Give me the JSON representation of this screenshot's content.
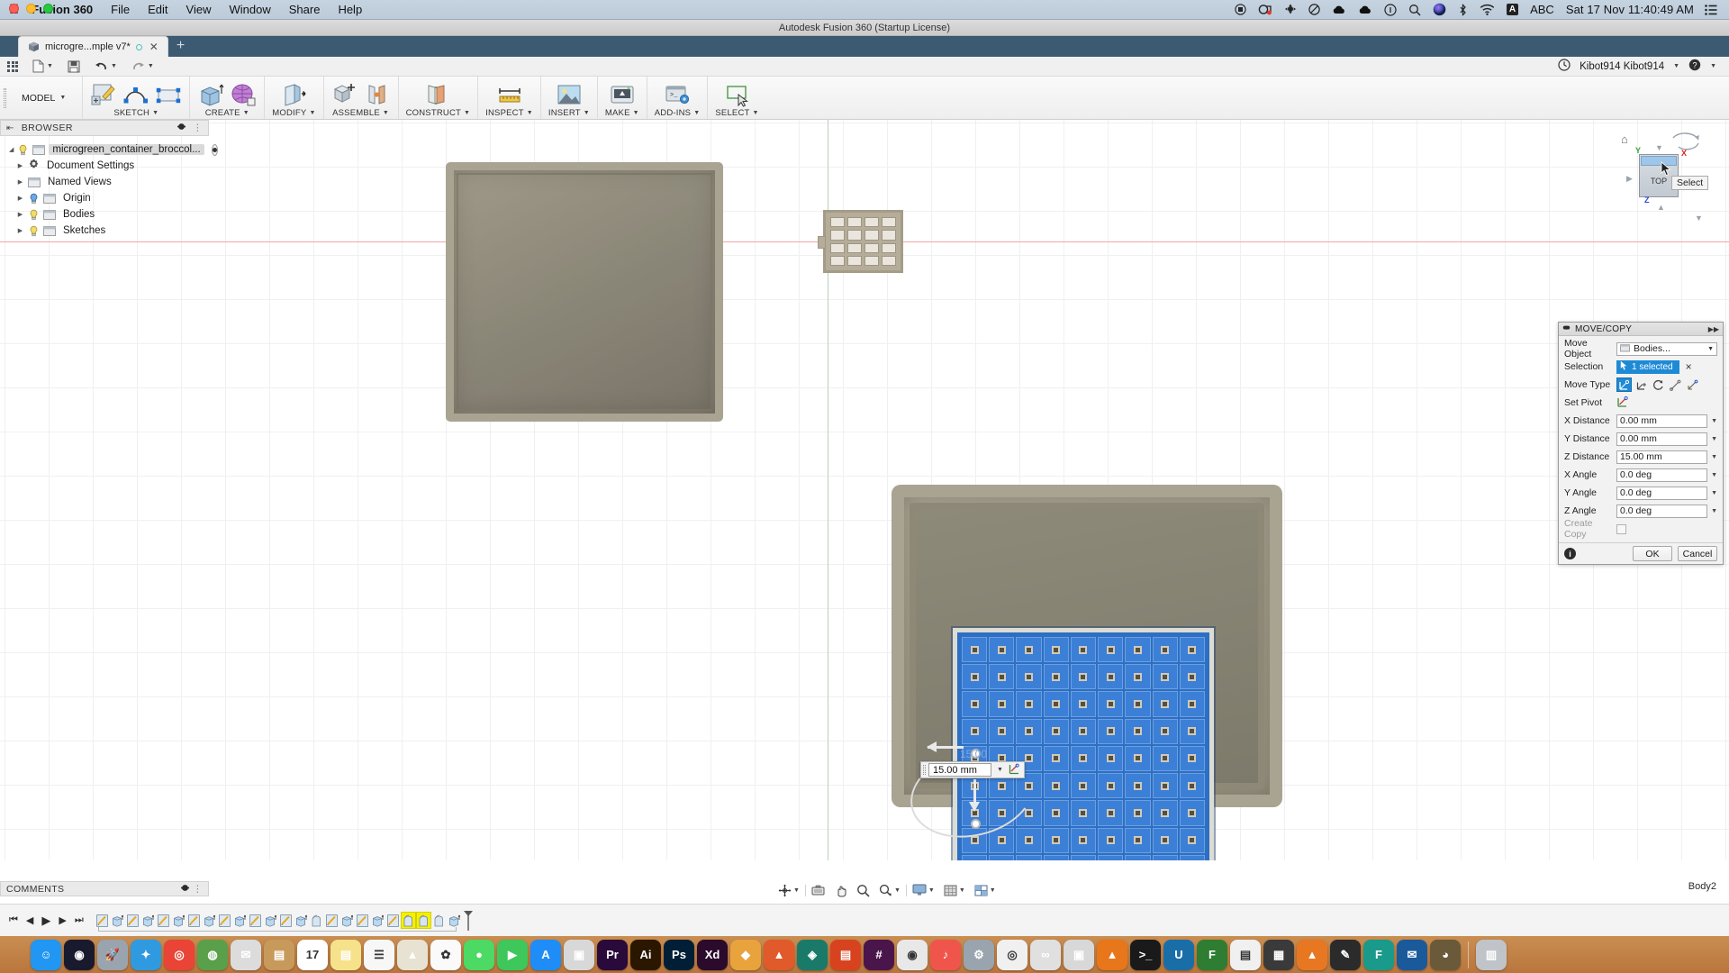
{
  "macbar": {
    "apple_icon": "apple-icon",
    "menus": [
      "Fusion 360",
      "File",
      "Edit",
      "View",
      "Window",
      "Share",
      "Help"
    ],
    "status_icons": [
      "screen-record-icon",
      "webcam-recording-icon",
      "airplay-icon",
      "dnd-icon",
      "cloud-up-icon",
      "cloud-down-icon",
      "info-circle-icon",
      "search-icon",
      "siri-icon",
      "bluetooth-icon",
      "wifi-icon"
    ],
    "input_source_badge": "A",
    "input_source_label": "ABC",
    "clock": "Sat 17 Nov  11:40:49 AM",
    "control_center_icon": "control-center-icon"
  },
  "titlebar": {
    "title": "Autodesk Fusion 360 (Startup License)"
  },
  "tabs": {
    "items": [
      {
        "label": "microgre...mple v7*",
        "icon": "cube-icon",
        "save_dot": "unsaved-indicator",
        "close": "close-icon"
      }
    ],
    "new_tab_label": "+"
  },
  "qat": {
    "apps_grid_icon": "app-grid-icon",
    "file_icon": "file-icon",
    "save_icon": "save-icon",
    "undo_icon": "undo-icon",
    "redo_icon": "redo-icon",
    "history_icon": "history-clock-icon",
    "account": "Kibot914 Kibot914",
    "help_icon": "help-icon"
  },
  "ribbon": {
    "workspace": "MODEL",
    "groups": [
      {
        "label": "SKETCH",
        "icons": [
          "create-sketch-icon",
          "spline-icon",
          "rectangle-icon"
        ]
      },
      {
        "label": "CREATE",
        "icons": [
          "extrude-icon",
          "form-icon"
        ]
      },
      {
        "label": "MODIFY",
        "icons": [
          "press-pull-icon"
        ]
      },
      {
        "label": "ASSEMBLE",
        "icons": [
          "new-component-icon",
          "joint-icon"
        ]
      },
      {
        "label": "CONSTRUCT",
        "icons": [
          "offset-plane-icon"
        ]
      },
      {
        "label": "INSPECT",
        "icons": [
          "measure-icon"
        ]
      },
      {
        "label": "INSERT",
        "icons": [
          "insert-image-icon"
        ]
      },
      {
        "label": "MAKE",
        "icons": [
          "3d-print-icon"
        ]
      },
      {
        "label": "ADD-INS",
        "icons": [
          "scripts-addins-icon"
        ]
      },
      {
        "label": "SELECT",
        "icons": [
          "select-icon"
        ]
      }
    ]
  },
  "browser": {
    "header": "BROWSER",
    "collapse_icon": "collapse-left-icon",
    "settings_icon": "panel-settings-icon",
    "root": {
      "label": "microgreen_container_broccol...",
      "bulb": "light-bulb-icon",
      "doc_icon": "document-icon",
      "visibility": "visibility-toggle"
    },
    "items": [
      {
        "label": "Document Settings",
        "icon": "gear-icon",
        "arrow": "chevron-right-icon"
      },
      {
        "label": "Named Views",
        "icon": "folder-icon",
        "arrow": "chevron-right-icon"
      },
      {
        "label": "Origin",
        "icon": "folder-icon",
        "arrow": "chevron-right-icon",
        "bulb": "light-bulb-on-icon"
      },
      {
        "label": "Bodies",
        "icon": "folder-icon",
        "arrow": "chevron-right-icon",
        "bulb": "light-bulb-icon"
      },
      {
        "label": "Sketches",
        "icon": "folder-icon",
        "arrow": "chevron-right-icon",
        "bulb": "light-bulb-icon"
      }
    ]
  },
  "viewcube": {
    "face_label": "TOP",
    "tooltip": "Select",
    "axis_x": "X",
    "axis_y": "Y",
    "axis_z": "Z",
    "home_icon": "home-icon",
    "orbit_icon": "orbit-arrow-icon"
  },
  "canvas": {
    "dimension_input": {
      "value": "15.00 mm",
      "ghost_label": "15.00",
      "dropdown_icon": "chevron-down-icon",
      "pivot_icon": "set-pivot-icon"
    },
    "arrow_left_icon": "move-arrow-left-icon",
    "arrow_down_icon": "move-arrow-down-icon"
  },
  "movecopy": {
    "title": "MOVE/COPY",
    "pin_icon": "pin-icon",
    "expand_icon": "expand-right-icon",
    "rows": [
      {
        "label": "Move Object",
        "type": "select",
        "value": "Bodies...",
        "icon": "bodies-icon"
      },
      {
        "label": "Selection",
        "type": "selectbtn",
        "value": "1 selected",
        "clear": "×",
        "icon": "cursor-icon"
      },
      {
        "label": "Move Type",
        "type": "movetype",
        "options": [
          "translate-rotate-icon",
          "point-to-point-icon",
          "rotate-icon",
          "point-to-position-icon",
          "free-move-icon"
        ],
        "active": 0
      },
      {
        "label": "Set Pivot",
        "type": "pivot",
        "icon": "set-pivot-icon"
      },
      {
        "label": "X Distance",
        "type": "field",
        "value": "0.00 mm"
      },
      {
        "label": "Y Distance",
        "type": "field",
        "value": "0.00 mm"
      },
      {
        "label": "Z Distance",
        "type": "field",
        "value": "15.00 mm"
      },
      {
        "label": "X Angle",
        "type": "field",
        "value": "0.0 deg"
      },
      {
        "label": "Y Angle",
        "type": "field",
        "value": "0.0 deg"
      },
      {
        "label": "Z Angle",
        "type": "field",
        "value": "0.0 deg"
      },
      {
        "label": "Create Copy",
        "type": "checkbox",
        "value": "",
        "disabled": true
      }
    ],
    "info_icon": "info-icon",
    "ok_label": "OK",
    "cancel_label": "Cancel",
    "accent_color": "#1e8ad6"
  },
  "navbar": {
    "items": [
      "orbit-icon",
      "pan-icon",
      "zoom-icon",
      "zoom-window-icon",
      "display-settings-icon",
      "grid-snaps-icon",
      "viewports-icon"
    ]
  },
  "statusbar": {
    "comments_label": "COMMENTS",
    "comments_settings_icon": "panel-settings-icon",
    "body_label": "Body2"
  },
  "timeline": {
    "nav": [
      "go-start-icon",
      "step-back-icon",
      "play-icon",
      "step-forward-icon",
      "go-end-icon"
    ],
    "feature_count": 24,
    "highlighted": [
      20,
      21
    ],
    "marker_icon": "timeline-marker-icon"
  },
  "dock": {
    "apps": [
      {
        "name": "finder",
        "color": "#2196f3",
        "glyph": "☺"
      },
      {
        "name": "siri",
        "color": "#1a1a2e",
        "glyph": "◉"
      },
      {
        "name": "launchpad",
        "color": "#9aa4ae",
        "glyph": "🚀"
      },
      {
        "name": "safari",
        "color": "#2f9ae0",
        "glyph": "✦"
      },
      {
        "name": "chrome",
        "color": "#e94435",
        "glyph": "◎"
      },
      {
        "name": "world-map",
        "color": "#5aa04a",
        "glyph": "◍"
      },
      {
        "name": "mail",
        "color": "#dcdcdc",
        "glyph": "✉"
      },
      {
        "name": "contacts",
        "color": "#c79a5c",
        "glyph": "▤"
      },
      {
        "name": "calendar",
        "color": "#ffffff",
        "glyph": "17"
      },
      {
        "name": "notes",
        "color": "#f6e28a",
        "glyph": "▤"
      },
      {
        "name": "reminders",
        "color": "#f7f7f7",
        "glyph": "☰"
      },
      {
        "name": "maps",
        "color": "#e8e2d2",
        "glyph": "▲"
      },
      {
        "name": "photos",
        "color": "#fafafa",
        "glyph": "✿"
      },
      {
        "name": "messages",
        "color": "#4cd964",
        "glyph": "●"
      },
      {
        "name": "facetime",
        "color": "#3ec75a",
        "glyph": "▶"
      },
      {
        "name": "appstore",
        "color": "#1f8df7",
        "glyph": "A"
      },
      {
        "name": "preview",
        "color": "#d8d8d8",
        "glyph": "▣"
      },
      {
        "name": "premiere",
        "color": "#2a0a3a",
        "glyph": "Pr"
      },
      {
        "name": "illustrator",
        "color": "#2b1700",
        "glyph": "Ai"
      },
      {
        "name": "photoshop",
        "color": "#001e36",
        "glyph": "Ps"
      },
      {
        "name": "xd",
        "color": "#2b0a2b",
        "glyph": "Xd"
      },
      {
        "name": "autocad",
        "color": "#e8a33d",
        "glyph": "◆"
      },
      {
        "name": "sketchup",
        "color": "#e05a2b",
        "glyph": "▲"
      },
      {
        "name": "fusion360",
        "color": "#1a7a6a",
        "glyph": "◈"
      },
      {
        "name": "eagle",
        "color": "#d8431f",
        "glyph": "▤"
      },
      {
        "name": "slack",
        "color": "#4a154b",
        "glyph": "#"
      },
      {
        "name": "siri2",
        "color": "#e8e8e8",
        "glyph": "◉"
      },
      {
        "name": "music",
        "color": "#f0554c",
        "glyph": "♪"
      },
      {
        "name": "system-preferences",
        "color": "#9aa4ae",
        "glyph": "⚙"
      },
      {
        "name": "rings",
        "color": "#f0f0f0",
        "glyph": "◎"
      },
      {
        "name": "loops",
        "color": "#e0e0e0",
        "glyph": "∞"
      },
      {
        "name": "drive",
        "color": "#d8d8d8",
        "glyph": "▣"
      },
      {
        "name": "vlc",
        "color": "#e8761a",
        "glyph": "▲"
      },
      {
        "name": "terminal",
        "color": "#1a1a1a",
        "glyph": ">_"
      },
      {
        "name": "ultimaker-cura",
        "color": "#1a6ea8",
        "glyph": "U"
      },
      {
        "name": "fontbook",
        "color": "#2e7d32",
        "glyph": "F"
      },
      {
        "name": "notes2",
        "color": "#f0f0f0",
        "glyph": "▤"
      },
      {
        "name": "calculator",
        "color": "#3a3a3a",
        "glyph": "▦"
      },
      {
        "name": "prusa",
        "color": "#e87722",
        "glyph": "▲"
      },
      {
        "name": "inkscape",
        "color": "#2b2b2b",
        "glyph": "✎"
      },
      {
        "name": "fusion-alt",
        "color": "#1a9a8a",
        "glyph": "F"
      },
      {
        "name": "thunderbird",
        "color": "#1a5a9a",
        "glyph": "✉"
      },
      {
        "name": "gimp",
        "color": "#6a5a3a",
        "glyph": "◕"
      },
      {
        "name": "trash",
        "color": "#c0c4c8",
        "glyph": "▥"
      }
    ]
  }
}
